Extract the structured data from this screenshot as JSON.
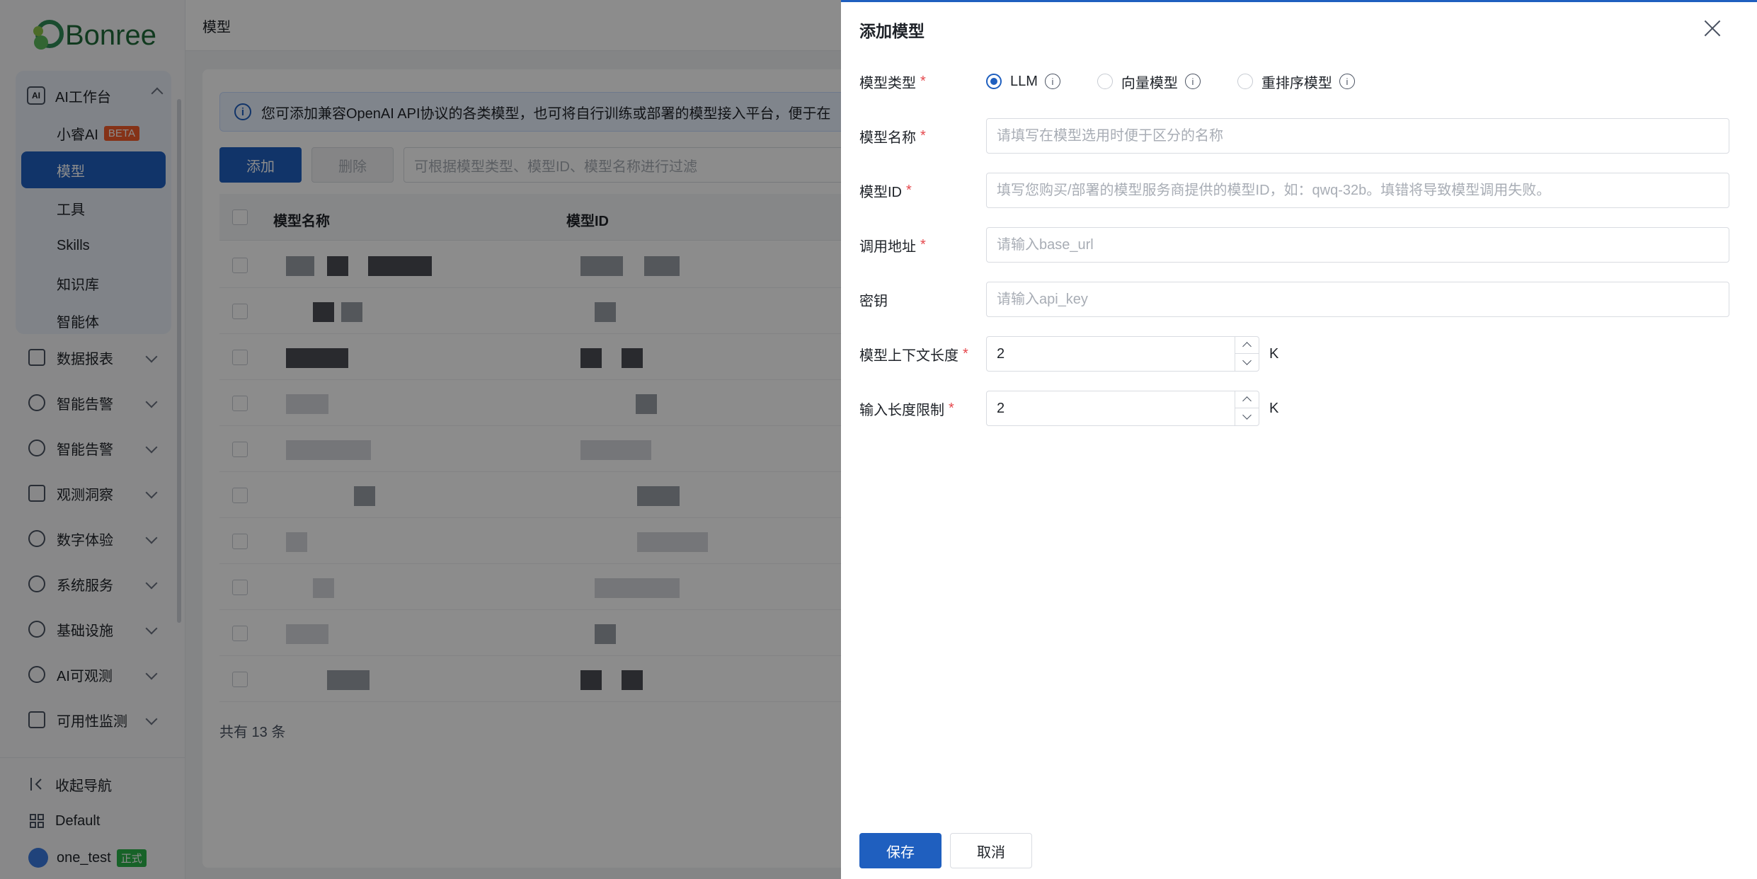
{
  "app": {
    "logo_text": "Bonree",
    "page_title": "模型"
  },
  "sidebar": {
    "ai_group": {
      "label": "AI工作台",
      "items": [
        {
          "label": "小睿AI",
          "badge": "BETA"
        },
        {
          "label": "模型"
        },
        {
          "label": "工具"
        },
        {
          "label": "Skills"
        },
        {
          "label": "知识库"
        },
        {
          "label": "智能体"
        }
      ]
    },
    "items": [
      {
        "label": "数据报表"
      },
      {
        "label": "智能告警"
      },
      {
        "label": "智能告警"
      },
      {
        "label": "观测洞察"
      },
      {
        "label": "数字体验"
      },
      {
        "label": "系统服务"
      },
      {
        "label": "基础设施"
      },
      {
        "label": "AI可观测"
      },
      {
        "label": "可用性监测"
      }
    ],
    "collapse_label": "收起导航",
    "workspace": "Default",
    "user": {
      "name": "one_test",
      "env_badge": "正式"
    }
  },
  "main": {
    "info_text": "您可添加兼容OpenAI API协议的各类模型，也可将自行训练或部署的模型接入平台，便于在",
    "add_label": "添加",
    "delete_label": "删除",
    "filter_placeholder": "可根据模型类型、模型ID、模型名称进行过滤",
    "columns": [
      "模型名称",
      "模型ID"
    ],
    "total_text": "共有 13 条"
  },
  "drawer": {
    "title": "添加模型",
    "model_type": {
      "label": "模型类型",
      "options": [
        "LLM",
        "向量模型",
        "重排序模型"
      ],
      "selected": "LLM"
    },
    "model_name": {
      "label": "模型名称",
      "placeholder": "请填写在模型选用时便于区分的名称"
    },
    "model_id": {
      "label": "模型ID",
      "placeholder": "填写您购买/部署的模型服务商提供的模型ID，如：qwq-32b。填错将导致模型调用失败。"
    },
    "base_url": {
      "label": "调用地址",
      "placeholder": "请输入base_url"
    },
    "api_key": {
      "label": "密钥",
      "placeholder": "请输入api_key"
    },
    "context_length": {
      "label": "模型上下文长度",
      "value": "2",
      "unit": "K"
    },
    "input_limit": {
      "label": "输入长度限制",
      "value": "2",
      "unit": "K"
    },
    "save_label": "保存",
    "cancel_label": "取消"
  },
  "colors": {
    "primary": "#1f5fbf",
    "required": "#e5484d",
    "beta_badge": "#f25c2a",
    "env_badge": "#2bb34a"
  }
}
